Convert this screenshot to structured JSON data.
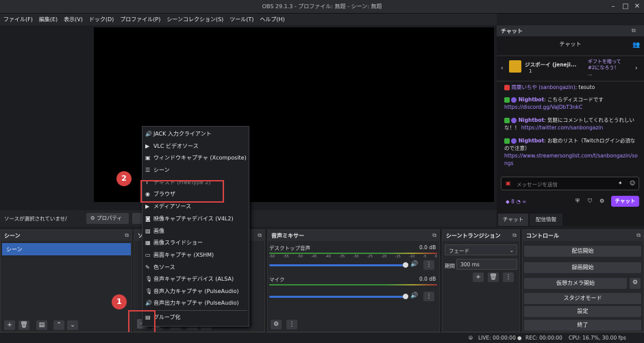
{
  "window": {
    "title": "OBS 29.1.3 - プロファイル: 無題 - シーン: 無題"
  },
  "menubar": [
    "ファイル(F)",
    "編集(E)",
    "表示(V)",
    "ドック(D)",
    "プロファイル(P)",
    "シーンコレクション(S)",
    "ツール(T)",
    "ヘルプ(H)"
  ],
  "source_bar": {
    "no_source_text": "ソースが選択されていませ/",
    "properties_label": "プロパティ"
  },
  "docks": {
    "scenes": {
      "title": "シーン",
      "items": [
        "シーン"
      ]
    },
    "sources": {
      "title": "ソ"
    },
    "mixer": {
      "title": "音声ミキサー",
      "channels": [
        {
          "name": "デスクトップ音声",
          "db": "0.0 dB"
        },
        {
          "name": "マイク",
          "db": "0.0 dB"
        }
      ],
      "scale": [
        "-60",
        "-55",
        "-50",
        "-45",
        "-40",
        "-35",
        "-30",
        "-25",
        "-20",
        "-15",
        "-10",
        "-5",
        "0"
      ]
    },
    "transitions": {
      "title": "シーントランジション",
      "transition": "フェード",
      "duration_label": "期間",
      "duration_value": "300 ms"
    },
    "controls": {
      "title": "コントロール",
      "buttons": [
        "配信開始",
        "録画開始",
        "仮想カメラ開始",
        "スタジオモード",
        "設定",
        "終了"
      ]
    }
  },
  "add_source_menu": {
    "items": [
      {
        "icon": "speaker-icon",
        "label": "JACK 入力クライアント"
      },
      {
        "icon": "play-icon",
        "label": "VLC ビデオソース"
      },
      {
        "icon": "window-icon",
        "label": "ウィンドウキャプチャ (Xcomposite)"
      },
      {
        "icon": "list-icon",
        "label": "シーン"
      },
      {
        "icon": "text-icon",
        "label": "テキスト (FreeType 2)"
      },
      {
        "icon": "globe-icon",
        "label": "ブラウザ"
      },
      {
        "icon": "play-icon",
        "label": "メディアソース"
      },
      {
        "icon": "camera-icon",
        "label": "映像キャプチャデバイス (V4L2)"
      },
      {
        "icon": "image-icon",
        "label": "画像"
      },
      {
        "icon": "slideshow-icon",
        "label": "画像スライドショー"
      },
      {
        "icon": "monitor-icon",
        "label": "画面キャプチャ (XSHM)"
      },
      {
        "icon": "brush-icon",
        "label": "色ソース"
      },
      {
        "icon": "mic-icon",
        "label": "音声キャプチャデバイス (ALSA)"
      },
      {
        "icon": "mic-icon",
        "label": "音声入力キャプチャ (PulseAudio)"
      },
      {
        "icon": "speaker-icon",
        "label": "音声出力キャプチャ (PulseAudio)"
      },
      {
        "icon": "folder-icon",
        "label": "グループ化"
      }
    ]
  },
  "callouts": {
    "one": "1",
    "two": "2"
  },
  "chat": {
    "title": "チャット",
    "header_label": "チャット",
    "gift_user": "ジスボーイ (jeneji...",
    "gift_count": "1",
    "gift_text": "ギフトを贈って #2になろう！",
    "gift_sub": "...",
    "messages": [
      {
        "user": "雨葉いちや (sanbongazin)",
        "text": ": tesuto"
      },
      {
        "user": "Nightbot",
        "text": ": こちらディスコードです",
        "link": "https://discord.gg/VaJDbT3nkC"
      },
      {
        "user": "Nightbot",
        "text": ": 気軽にコメントしてくれるとうれしいな！！",
        "link": "https://twitter.com/sanbongazin"
      },
      {
        "user": "Nightbot",
        "text": ": お歌のリスト（Twitchログイン必須なので注意）",
        "link": "https://www.streamersonglist.com/t/sanbongazin/songs"
      }
    ],
    "input_placeholder": "メッセージを送信",
    "points": "8",
    "infinity": "∞",
    "send_label": "チャット",
    "tabs": [
      "チャット",
      "配信情報"
    ]
  },
  "status": {
    "live": "LIVE: 00:00:00",
    "rec": "REC: 00:00:00",
    "cpu": "CPU: 16.7%, 30.00 fps"
  },
  "colors": {
    "accent": "#3b6fd4",
    "callout": "#d94343",
    "twitch": "#9147ff"
  }
}
